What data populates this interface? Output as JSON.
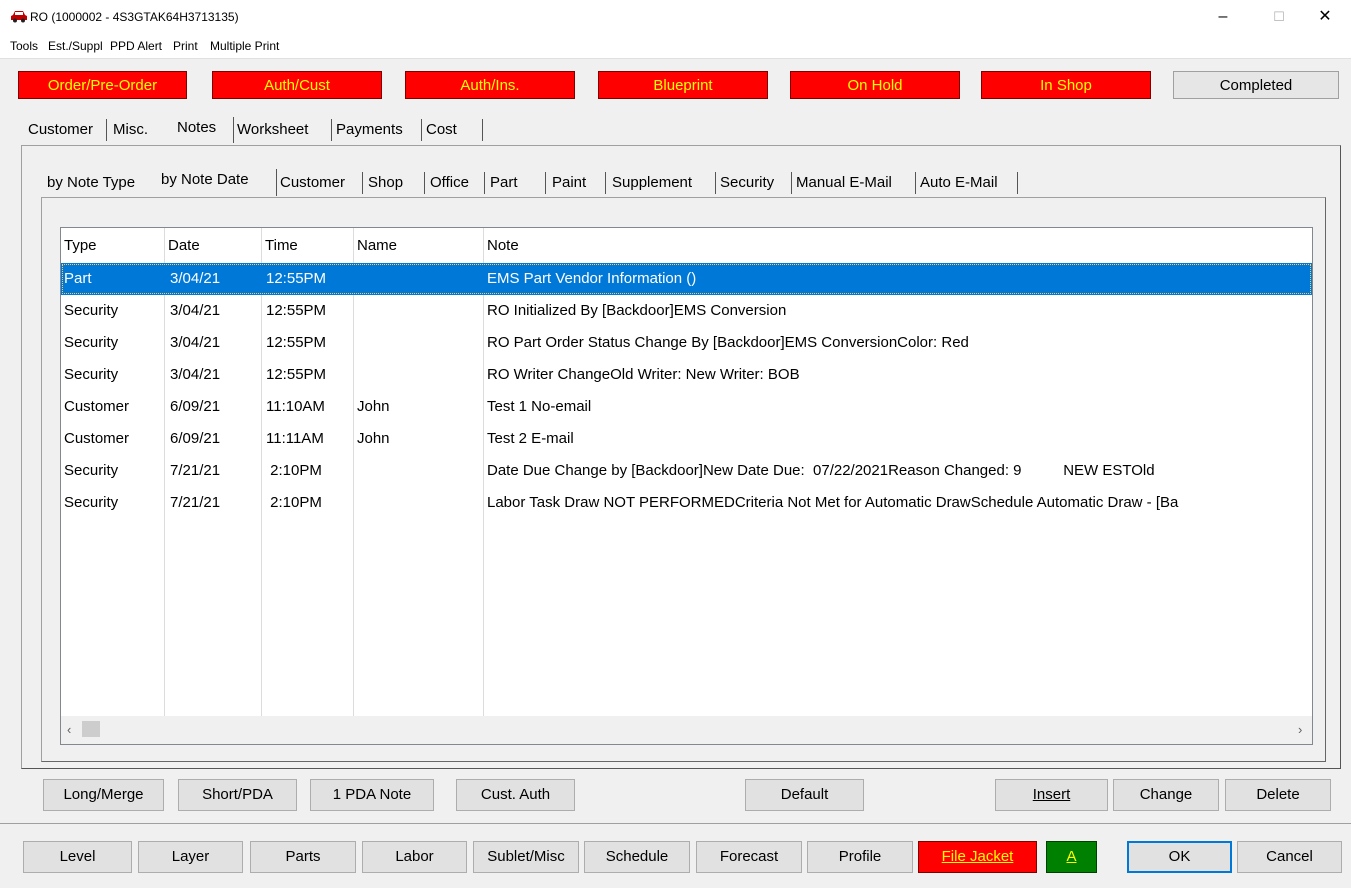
{
  "window": {
    "title": "RO (1000002 - 4S3GTAK64H3713135)",
    "minimize": "–",
    "maximize": "☐",
    "close": "✕"
  },
  "menu": [
    "Tools",
    "Est./Suppl",
    "PPD Alert",
    "Print",
    "Multiple Print"
  ],
  "status_buttons": [
    "Order/Pre-Order",
    "Auth/Cust",
    "Auth/Ins.",
    "Blueprint",
    "On Hold",
    "In Shop",
    "Completed"
  ],
  "main_tabs": [
    "Customer",
    "Misc.",
    "Notes",
    "Worksheet",
    "Payments",
    "Cost"
  ],
  "sub_tabs": [
    "by Note Type",
    "by Note Date",
    "Customer",
    "Shop",
    "Office",
    "Part",
    "Paint",
    "Supplement",
    "Security",
    "Manual E-Mail",
    "Auto E-Mail"
  ],
  "table": {
    "columns": [
      "Type",
      "Date",
      "Time",
      "Name",
      "Note"
    ],
    "rows": [
      [
        "Part",
        "3/04/21",
        "12:55PM",
        "",
        "EMS Part Vendor Information ()"
      ],
      [
        "Security",
        "3/04/21",
        "12:55PM",
        "",
        "RO Initialized By [Backdoor]EMS Conversion"
      ],
      [
        "Security",
        "3/04/21",
        "12:55PM",
        "",
        "RO Part Order Status Change By [Backdoor]EMS ConversionColor:  Red"
      ],
      [
        "Security",
        "3/04/21",
        "12:55PM",
        "",
        "RO Writer ChangeOld Writer: New Writer: BOB"
      ],
      [
        "Customer",
        "6/09/21",
        "11:10AM",
        "John",
        "Test 1 No-email"
      ],
      [
        "Customer",
        "6/09/21",
        "11:11AM",
        "John",
        "Test 2 E-mail"
      ],
      [
        "Security",
        "7/21/21",
        " 2:10PM",
        "",
        "Date Due Change by [Backdoor]New Date Due:  07/22/2021Reason Changed: 9          NEW ESTOld"
      ],
      [
        "Security",
        "7/21/21",
        " 2:10PM",
        "",
        "Labor Task Draw NOT PERFORMEDCriteria Not Met for Automatic DrawSchedule Automatic Draw - [Ba"
      ]
    ],
    "scroll_left": "‹",
    "scroll_right": "›"
  },
  "note_buttons": {
    "long_merge": "Long/Merge",
    "short_pda": "Short/PDA",
    "one_pda_note": "1 PDA Note",
    "cust_auth": "Cust. Auth",
    "default": "Default",
    "insert": "Insert",
    "change": "Change",
    "delete": "Delete"
  },
  "bottom_buttons": {
    "level": "Level",
    "layer": "Layer",
    "parts": "Parts",
    "labor": "Labor",
    "sublet_misc": "Sublet/Misc",
    "schedule": "Schedule",
    "forecast": "Forecast",
    "profile": "Profile",
    "file_jacket": "File Jacket",
    "a": "A",
    "ok": "OK",
    "cancel": "Cancel"
  },
  "colors": {
    "status_red": "#ff0000",
    "status_text": "#ffff00",
    "selection": "#0078d7",
    "green": "#008000"
  }
}
